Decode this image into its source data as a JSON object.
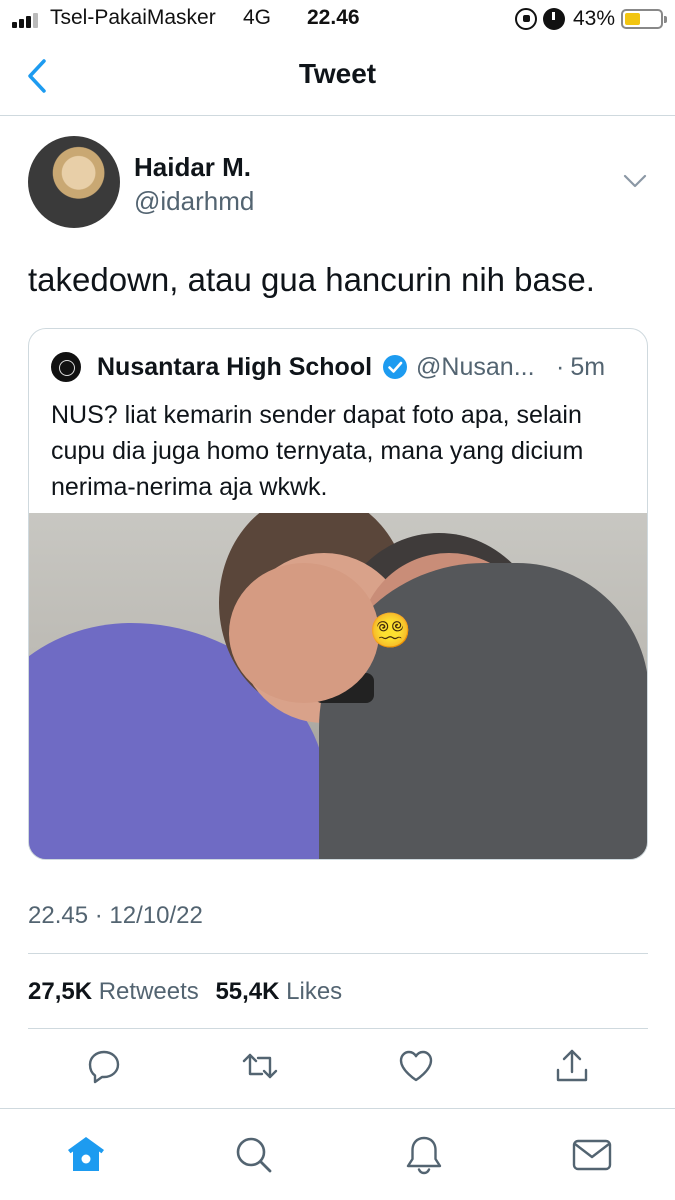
{
  "status_bar": {
    "carrier": "Tsel-PakaiMasker",
    "network": "4G",
    "time": "22.46",
    "battery_percent_label": "43%",
    "battery_level": 0.43,
    "battery_color": "#f2c511"
  },
  "header": {
    "title": "Tweet",
    "back_icon": "chevron-left-icon"
  },
  "tweet": {
    "author": {
      "display_name": "Haidar M.",
      "handle": "@idarhmd"
    },
    "text": "takedown, atau gua hancurin nih base.",
    "timestamp": "22.45 · 12/10/22",
    "stats": {
      "retweets_count": "27,5K",
      "retweets_label": "Retweets",
      "likes_count": "55,4K",
      "likes_label": "Likes"
    }
  },
  "quoted_tweet": {
    "display_name": "Nusantara High School",
    "verified": true,
    "handle": "@Nusan...",
    "separator": "·",
    "time": "5m",
    "text": "NUS? liat kemarin sender dapat foto apa, selain cupu dia juga homo ternyata, mana yang dicium nerima-nerima aja wkwk.",
    "image_overlay_emoji": "😵‍💫"
  },
  "actions": [
    "reply-icon",
    "retweet-icon",
    "like-icon",
    "share-icon"
  ],
  "tabs": [
    "home-icon",
    "search-icon",
    "notifications-icon",
    "messages-icon"
  ],
  "colors": {
    "accent": "#1d9bf0",
    "secondary_text": "#536471",
    "icon_gray": "#536471"
  }
}
